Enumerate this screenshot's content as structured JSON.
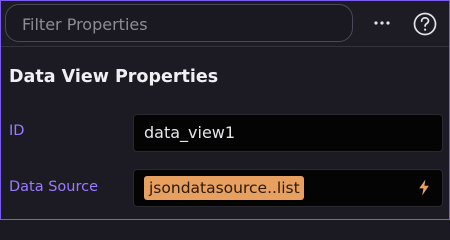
{
  "filter": {
    "placeholder": "Filter Properties"
  },
  "toolbar": {
    "more_icon": "more-horizontal-icon",
    "help_icon": "help-circle-icon"
  },
  "section": {
    "title": "Data View Properties"
  },
  "properties": [
    {
      "label": "ID",
      "value": "data_view1"
    },
    {
      "label": "Data Source",
      "value": "jsondatasource..list",
      "binding_icon": "lightning-bolt-icon"
    }
  ],
  "colors": {
    "accent": "#9b7bff",
    "border_focus": "#7a5cf0",
    "chip_bg": "#e7a060",
    "bolt": "#e7a060"
  }
}
